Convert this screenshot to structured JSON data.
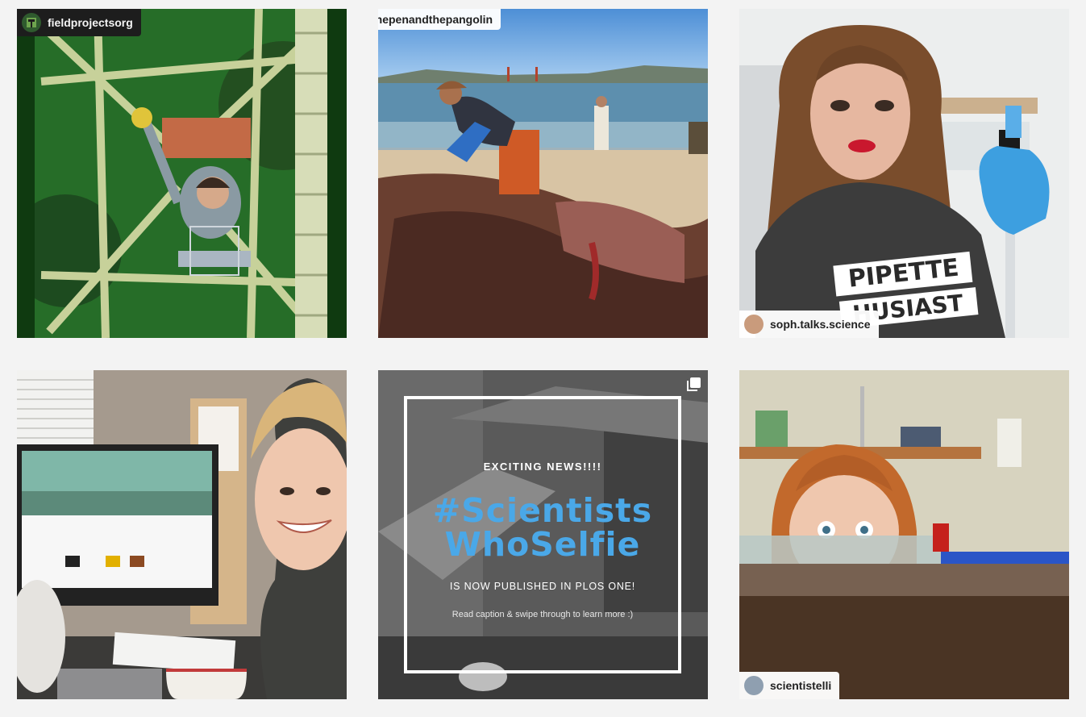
{
  "posts": [
    {
      "handle": "fieldprojectsorg",
      "avatar_icon": "tree-logo-icon",
      "scene": "researcher climbing green tower in forest"
    },
    {
      "handle": "thepenandthepangolin",
      "scene": "scientists at beach with bridge"
    },
    {
      "handle": "soph.talks.science",
      "shirt_text": [
        "PIPETTE",
        "HUSIAST"
      ],
      "scene": "lab selfie with pipette"
    },
    {
      "handle": "",
      "scene": "researcher at desk with monitor"
    },
    {
      "kicker": "EXCITING NEWS!!!!",
      "hashtag_line1": "#Scientists",
      "hashtag_line2": "WhoSelfie",
      "published": "IS NOW PUBLISHED IN PLOS ONE!",
      "caption": "Read caption & swipe through to learn more :)",
      "carousel_icon": "multiple-images-icon"
    },
    {
      "handle": "scientistelli",
      "scene": "eyes peeking over lab bench"
    }
  ],
  "colors": {
    "background": "#f3f3f3",
    "hashtag": "#4aa8e8"
  }
}
